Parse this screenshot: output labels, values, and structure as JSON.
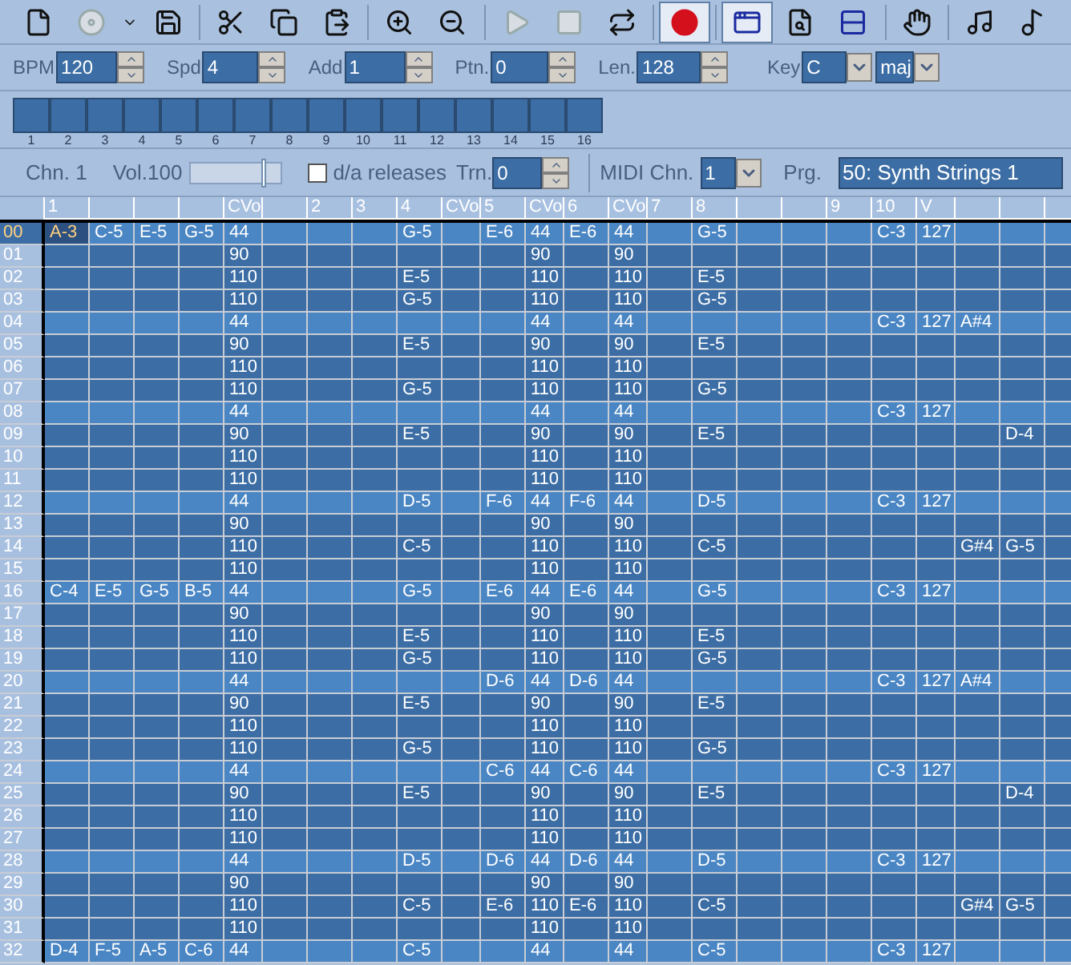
{
  "toolbar": [
    {
      "pressed": false,
      "disabled": false
    },
    {
      "pressed": false,
      "disabled": true
    },
    {
      "pressed": false,
      "disabled": false
    },
    {
      "pressed": false,
      "disabled": false
    },
    {
      "pressed": false,
      "disabled": false
    },
    {
      "pressed": false,
      "disabled": false
    },
    {
      "pressed": false,
      "disabled": false
    },
    {
      "pressed": false,
      "disabled": false
    },
    {
      "pressed": false,
      "disabled": false
    },
    {
      "pressed": false,
      "disabled": true
    },
    {
      "pressed": false,
      "disabled": true
    },
    {
      "pressed": false,
      "disabled": false
    },
    {
      "pressed": true,
      "disabled": false
    },
    {
      "pressed": true,
      "disabled": false
    },
    {
      "pressed": false,
      "disabled": false
    },
    {
      "pressed": false,
      "disabled": false
    },
    {
      "pressed": false,
      "disabled": false
    },
    {
      "pressed": false,
      "disabled": false
    },
    {
      "pressed": false,
      "disabled": false
    }
  ],
  "settings": [
    {
      "kind": "spinner",
      "label": "BPM",
      "value": "120"
    },
    {
      "kind": "spinner",
      "label": "Spd",
      "value": "4"
    },
    {
      "kind": "spinner",
      "label": "Add",
      "value": "1"
    },
    {
      "kind": "spinner",
      "label": "Ptn.",
      "value": "0"
    },
    {
      "kind": "spinner",
      "label": "Len.",
      "value": "128"
    },
    {
      "kind": "dropdown",
      "label": "Key",
      "value": "C"
    },
    {
      "kind": "dropdown",
      "value": "maj"
    }
  ],
  "patterns": [
    "1",
    "2",
    "3",
    "4",
    "5",
    "6",
    "7",
    "8",
    "9",
    "10",
    "11",
    "12",
    "13",
    "14",
    "15",
    "16"
  ],
  "channel": {
    "label": "Chn. 1",
    "volume_label": "Vol.100",
    "volume": {
      "level": 0.8
    },
    "releases": {
      "label": "d/a releases",
      "checked": false
    },
    "transpose": {
      "label": "Trn.",
      "value": "0"
    },
    "midi_channel": {
      "label": "MIDI Chn.",
      "value": "1"
    },
    "program": {
      "label": "Prg.",
      "value": "50: Synth Strings 1"
    }
  },
  "columns": [
    "1",
    null,
    null,
    null,
    "CVo",
    null,
    "2",
    "3",
    "4",
    "CVo",
    "5",
    "CVo",
    "6",
    "CVo",
    "7",
    "8",
    null,
    null,
    "9",
    "10",
    "V",
    null,
    null,
    null
  ],
  "rows": [
    {
      "number": "00",
      "highlighted": true,
      "selected": true,
      "cells": [
        "A-3",
        "C-5",
        "E-5",
        "G-5",
        "44",
        null,
        null,
        null,
        "G-5",
        null,
        "E-6",
        "44",
        "E-6",
        "44",
        null,
        "G-5",
        null,
        null,
        null,
        "C-3",
        "127",
        null,
        null,
        null
      ]
    },
    {
      "number": "01",
      "highlighted": false,
      "selected": false,
      "cells": [
        null,
        null,
        null,
        null,
        "90",
        null,
        null,
        null,
        null,
        null,
        null,
        "90",
        null,
        "90",
        null,
        null,
        null,
        null,
        null,
        null,
        null,
        null,
        null,
        null
      ]
    },
    {
      "number": "02",
      "highlighted": false,
      "selected": false,
      "cells": [
        null,
        null,
        null,
        null,
        "110",
        null,
        null,
        null,
        "E-5",
        null,
        null,
        "110",
        null,
        "110",
        null,
        "E-5",
        null,
        null,
        null,
        null,
        null,
        null,
        null,
        null
      ]
    },
    {
      "number": "03",
      "highlighted": false,
      "selected": false,
      "cells": [
        null,
        null,
        null,
        null,
        "110",
        null,
        null,
        null,
        "G-5",
        null,
        null,
        "110",
        null,
        "110",
        null,
        "G-5",
        null,
        null,
        null,
        null,
        null,
        null,
        null,
        null
      ]
    },
    {
      "number": "04",
      "highlighted": true,
      "selected": false,
      "cells": [
        null,
        null,
        null,
        null,
        "44",
        null,
        null,
        null,
        null,
        null,
        null,
        "44",
        null,
        "44",
        null,
        null,
        null,
        null,
        null,
        "C-3",
        "127",
        "A#4",
        null,
        null
      ]
    },
    {
      "number": "05",
      "highlighted": false,
      "selected": false,
      "cells": [
        null,
        null,
        null,
        null,
        "90",
        null,
        null,
        null,
        "E-5",
        null,
        null,
        "90",
        null,
        "90",
        null,
        "E-5",
        null,
        null,
        null,
        null,
        null,
        null,
        null,
        null
      ]
    },
    {
      "number": "06",
      "highlighted": false,
      "selected": false,
      "cells": [
        null,
        null,
        null,
        null,
        "110",
        null,
        null,
        null,
        null,
        null,
        null,
        "110",
        null,
        "110",
        null,
        null,
        null,
        null,
        null,
        null,
        null,
        null,
        null,
        null
      ]
    },
    {
      "number": "07",
      "highlighted": false,
      "selected": false,
      "cells": [
        null,
        null,
        null,
        null,
        "110",
        null,
        null,
        null,
        "G-5",
        null,
        null,
        "110",
        null,
        "110",
        null,
        "G-5",
        null,
        null,
        null,
        null,
        null,
        null,
        null,
        null
      ]
    },
    {
      "number": "08",
      "highlighted": true,
      "selected": false,
      "cells": [
        null,
        null,
        null,
        null,
        "44",
        null,
        null,
        null,
        null,
        null,
        null,
        "44",
        null,
        "44",
        null,
        null,
        null,
        null,
        null,
        "C-3",
        "127",
        null,
        null,
        null
      ]
    },
    {
      "number": "09",
      "highlighted": false,
      "selected": false,
      "cells": [
        null,
        null,
        null,
        null,
        "90",
        null,
        null,
        null,
        "E-5",
        null,
        null,
        "90",
        null,
        "90",
        null,
        "E-5",
        null,
        null,
        null,
        null,
        null,
        null,
        "D-4",
        null
      ]
    },
    {
      "number": "10",
      "highlighted": false,
      "selected": false,
      "cells": [
        null,
        null,
        null,
        null,
        "110",
        null,
        null,
        null,
        null,
        null,
        null,
        "110",
        null,
        "110",
        null,
        null,
        null,
        null,
        null,
        null,
        null,
        null,
        null,
        null
      ]
    },
    {
      "number": "11",
      "highlighted": false,
      "selected": false,
      "cells": [
        null,
        null,
        null,
        null,
        "110",
        null,
        null,
        null,
        null,
        null,
        null,
        "110",
        null,
        "110",
        null,
        null,
        null,
        null,
        null,
        null,
        null,
        null,
        null,
        null
      ]
    },
    {
      "number": "12",
      "highlighted": true,
      "selected": false,
      "cells": [
        null,
        null,
        null,
        null,
        "44",
        null,
        null,
        null,
        "D-5",
        null,
        "F-6",
        "44",
        "F-6",
        "44",
        null,
        "D-5",
        null,
        null,
        null,
        "C-3",
        "127",
        null,
        null,
        null
      ]
    },
    {
      "number": "13",
      "highlighted": false,
      "selected": false,
      "cells": [
        null,
        null,
        null,
        null,
        "90",
        null,
        null,
        null,
        null,
        null,
        null,
        "90",
        null,
        "90",
        null,
        null,
        null,
        null,
        null,
        null,
        null,
        null,
        null,
        null
      ]
    },
    {
      "number": "14",
      "highlighted": false,
      "selected": false,
      "cells": [
        null,
        null,
        null,
        null,
        "110",
        null,
        null,
        null,
        "C-5",
        null,
        null,
        "110",
        null,
        "110",
        null,
        "C-5",
        null,
        null,
        null,
        null,
        null,
        "G#4",
        "G-5",
        null
      ]
    },
    {
      "number": "15",
      "highlighted": false,
      "selected": false,
      "cells": [
        null,
        null,
        null,
        null,
        "110",
        null,
        null,
        null,
        null,
        null,
        null,
        "110",
        null,
        "110",
        null,
        null,
        null,
        null,
        null,
        null,
        null,
        null,
        null,
        null
      ]
    },
    {
      "number": "16",
      "highlighted": true,
      "selected": false,
      "cells": [
        "C-4",
        "E-5",
        "G-5",
        "B-5",
        "44",
        null,
        null,
        null,
        "G-5",
        null,
        "E-6",
        "44",
        "E-6",
        "44",
        null,
        "G-5",
        null,
        null,
        null,
        "C-3",
        "127",
        null,
        null,
        null
      ]
    },
    {
      "number": "17",
      "highlighted": false,
      "selected": false,
      "cells": [
        null,
        null,
        null,
        null,
        "90",
        null,
        null,
        null,
        null,
        null,
        null,
        "90",
        null,
        "90",
        null,
        null,
        null,
        null,
        null,
        null,
        null,
        null,
        null,
        null
      ]
    },
    {
      "number": "18",
      "highlighted": false,
      "selected": false,
      "cells": [
        null,
        null,
        null,
        null,
        "110",
        null,
        null,
        null,
        "E-5",
        null,
        null,
        "110",
        null,
        "110",
        null,
        "E-5",
        null,
        null,
        null,
        null,
        null,
        null,
        null,
        null
      ]
    },
    {
      "number": "19",
      "highlighted": false,
      "selected": false,
      "cells": [
        null,
        null,
        null,
        null,
        "110",
        null,
        null,
        null,
        "G-5",
        null,
        null,
        "110",
        null,
        "110",
        null,
        "G-5",
        null,
        null,
        null,
        null,
        null,
        null,
        null,
        null
      ]
    },
    {
      "number": "20",
      "highlighted": true,
      "selected": false,
      "cells": [
        null,
        null,
        null,
        null,
        "44",
        null,
        null,
        null,
        null,
        null,
        "D-6",
        "44",
        "D-6",
        "44",
        null,
        null,
        null,
        null,
        null,
        "C-3",
        "127",
        "A#4",
        null,
        null
      ]
    },
    {
      "number": "21",
      "highlighted": false,
      "selected": false,
      "cells": [
        null,
        null,
        null,
        null,
        "90",
        null,
        null,
        null,
        "E-5",
        null,
        null,
        "90",
        null,
        "90",
        null,
        "E-5",
        null,
        null,
        null,
        null,
        null,
        null,
        null,
        null
      ]
    },
    {
      "number": "22",
      "highlighted": false,
      "selected": false,
      "cells": [
        null,
        null,
        null,
        null,
        "110",
        null,
        null,
        null,
        null,
        null,
        null,
        "110",
        null,
        "110",
        null,
        null,
        null,
        null,
        null,
        null,
        null,
        null,
        null,
        null
      ]
    },
    {
      "number": "23",
      "highlighted": false,
      "selected": false,
      "cells": [
        null,
        null,
        null,
        null,
        "110",
        null,
        null,
        null,
        "G-5",
        null,
        null,
        "110",
        null,
        "110",
        null,
        "G-5",
        null,
        null,
        null,
        null,
        null,
        null,
        null,
        null
      ]
    },
    {
      "number": "24",
      "highlighted": true,
      "selected": false,
      "cells": [
        null,
        null,
        null,
        null,
        "44",
        null,
        null,
        null,
        null,
        null,
        "C-6",
        "44",
        "C-6",
        "44",
        null,
        null,
        null,
        null,
        null,
        "C-3",
        "127",
        null,
        null,
        null
      ]
    },
    {
      "number": "25",
      "highlighted": false,
      "selected": false,
      "cells": [
        null,
        null,
        null,
        null,
        "90",
        null,
        null,
        null,
        "E-5",
        null,
        null,
        "90",
        null,
        "90",
        null,
        "E-5",
        null,
        null,
        null,
        null,
        null,
        null,
        "D-4",
        null
      ]
    },
    {
      "number": "26",
      "highlighted": false,
      "selected": false,
      "cells": [
        null,
        null,
        null,
        null,
        "110",
        null,
        null,
        null,
        null,
        null,
        null,
        "110",
        null,
        "110",
        null,
        null,
        null,
        null,
        null,
        null,
        null,
        null,
        null,
        null
      ]
    },
    {
      "number": "27",
      "highlighted": false,
      "selected": false,
      "cells": [
        null,
        null,
        null,
        null,
        "110",
        null,
        null,
        null,
        null,
        null,
        null,
        "110",
        null,
        "110",
        null,
        null,
        null,
        null,
        null,
        null,
        null,
        null,
        null,
        null
      ]
    },
    {
      "number": "28",
      "highlighted": true,
      "selected": false,
      "cells": [
        null,
        null,
        null,
        null,
        "44",
        null,
        null,
        null,
        "D-5",
        null,
        "D-6",
        "44",
        "D-6",
        "44",
        null,
        "D-5",
        null,
        null,
        null,
        "C-3",
        "127",
        null,
        null,
        null
      ]
    },
    {
      "number": "29",
      "highlighted": false,
      "selected": false,
      "cells": [
        null,
        null,
        null,
        null,
        "90",
        null,
        null,
        null,
        null,
        null,
        null,
        "90",
        null,
        "90",
        null,
        null,
        null,
        null,
        null,
        null,
        null,
        null,
        null,
        null
      ]
    },
    {
      "number": "30",
      "highlighted": false,
      "selected": false,
      "cells": [
        null,
        null,
        null,
        null,
        "110",
        null,
        null,
        null,
        "C-5",
        null,
        "E-6",
        "110",
        "E-6",
        "110",
        null,
        "C-5",
        null,
        null,
        null,
        null,
        null,
        "G#4",
        "G-5",
        null
      ]
    },
    {
      "number": "31",
      "highlighted": false,
      "selected": false,
      "cells": [
        null,
        null,
        null,
        null,
        "110",
        null,
        null,
        null,
        null,
        null,
        null,
        "110",
        null,
        "110",
        null,
        null,
        null,
        null,
        null,
        null,
        null,
        null,
        null,
        null
      ]
    },
    {
      "number": "32",
      "highlighted": true,
      "selected": false,
      "cells": [
        "D-4",
        "F-5",
        "A-5",
        "C-6",
        "44",
        null,
        null,
        null,
        "C-5",
        null,
        null,
        "44",
        null,
        "44",
        null,
        "C-5",
        null,
        null,
        null,
        "C-3",
        "127",
        null,
        null,
        null
      ]
    }
  ]
}
